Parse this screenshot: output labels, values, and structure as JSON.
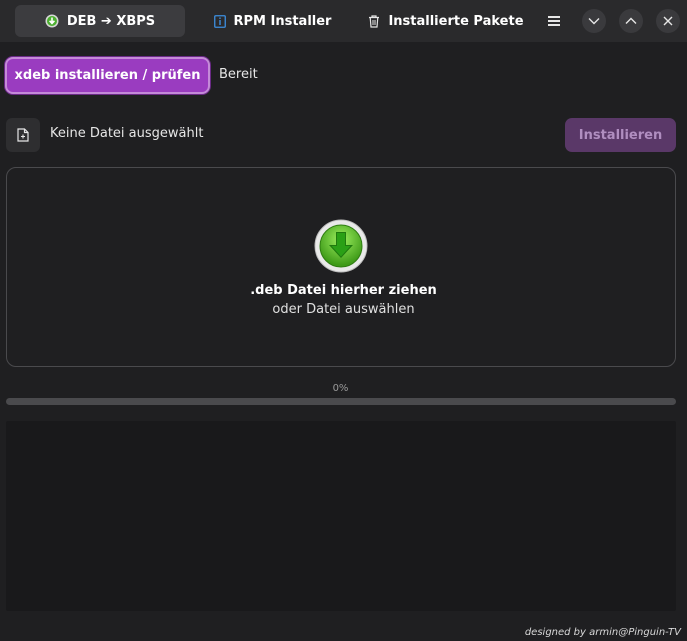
{
  "header": {
    "tabs": [
      {
        "label": "DEB ➔ XBPS",
        "icon": "deb-download-icon",
        "active": true
      },
      {
        "label": "RPM Installer",
        "icon": "info-icon",
        "active": false
      },
      {
        "label": "Installierte Pakete",
        "icon": "trash-icon",
        "active": false
      }
    ],
    "menu_icon": "hamburger-menu-icon",
    "window_controls": [
      "chevron-down-icon",
      "chevron-up-icon",
      "close-icon"
    ]
  },
  "action": {
    "button_label": "xdeb installieren / prüfen",
    "status": "Bereit"
  },
  "file": {
    "icon": "file-icon",
    "selected_label": "Keine Datei ausgewählt",
    "install_label": "Installieren",
    "install_enabled": false
  },
  "dropzone": {
    "icon": "green-download-icon",
    "title": ".deb Datei hierher ziehen",
    "subtitle": "oder Datei auswählen"
  },
  "progress": {
    "label": "0%",
    "value": 0
  },
  "log": {
    "text": ""
  },
  "footer": {
    "credit": "designed by armin@Pinguin-TV"
  },
  "colors": {
    "accent": "#9a3cc0",
    "background": "#1f1f21",
    "header": "#2a2a2c",
    "install_disabled": "#5a3868"
  }
}
